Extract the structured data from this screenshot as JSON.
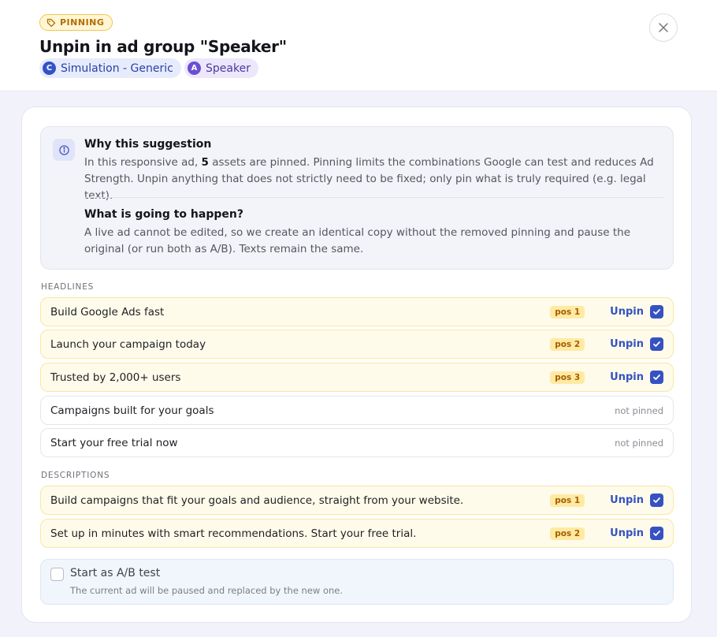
{
  "header": {
    "tag": "PINNING",
    "title": "Unpin in ad group \"Speaker\"",
    "campaign_badge": "C",
    "campaign": "Simulation - Generic",
    "adgroup_badge": "A",
    "adgroup": "Speaker"
  },
  "info": {
    "why_title": "Why this suggestion",
    "why_pre": "In this responsive ad, ",
    "why_count": "5",
    "why_post": " assets are pinned. Pinning limits the combinations Google can test and reduces Ad Strength. Unpin anything that does not strictly need to be fixed; only pin what is truly required (e.g. legal text).",
    "happen_title": "What is going to happen?",
    "happen_text": "A live ad cannot be edited, so we create an identical copy without the removed pinning and pause the original (or run both as A/B). Texts remain the same."
  },
  "headlines": {
    "label": "HEADLINES",
    "items": [
      {
        "text": "Build Google Ads fast",
        "pos": "pos 1",
        "action": "Unpin"
      },
      {
        "text": "Launch your campaign today",
        "pos": "pos 2",
        "action": "Unpin"
      },
      {
        "text": "Trusted by 2,000+ users",
        "pos": "pos 3",
        "action": "Unpin"
      },
      {
        "text": "Campaigns built for your goals",
        "status": "not pinned"
      },
      {
        "text": "Start your free trial now",
        "status": "not pinned"
      }
    ]
  },
  "descriptions": {
    "label": "DESCRIPTIONS",
    "items": [
      {
        "text": "Build campaigns that fit your goals and audience, straight from your website.",
        "pos": "pos 1",
        "action": "Unpin"
      },
      {
        "text": "Set up in minutes with smart recommendations. Start your free trial.",
        "pos": "pos 2",
        "action": "Unpin"
      }
    ]
  },
  "ab_test": {
    "label": "Start as A/B test",
    "hint": "The current ad will be paused and replaced by the new one."
  },
  "colors": {
    "accent": "#3652c2",
    "pinned_bg": "#fffbea",
    "tag_text": "#b46d00"
  }
}
